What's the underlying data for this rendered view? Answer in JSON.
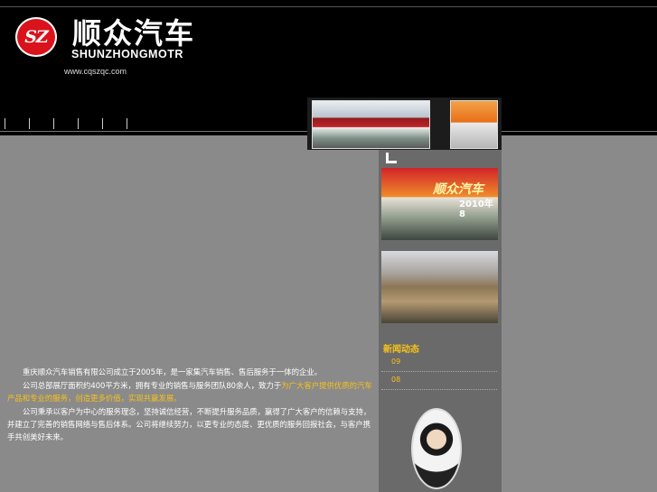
{
  "header": {
    "logo_mark": "SZ",
    "brand_cn": "顺众汽车",
    "brand_en": "SHUNZHONGMOTR",
    "url": "www.cqszqc.com"
  },
  "nav": {
    "items": [
      "",
      "",
      "",
      "",
      "",
      ""
    ]
  },
  "banner_photos": [
    "dealership-front-photo",
    "dealership-entrance-photo"
  ],
  "sidebar": {
    "photo_event_text": "顺众汽车",
    "photo_event_sub": "2010年8",
    "news_title": "新闻动态",
    "news_items": [
      {
        "date": "09"
      },
      {
        "date": "08"
      }
    ]
  },
  "content": {
    "p1": "重庆顺众汽车销售有限公司成立于2005年，是一家集汽车销售、售后服务于一体的企业。",
    "p2_a": "公司总部展厅面积约400平方米，拥有专业的销售与服务团队80余人，致力于",
    "p2_highlight": "为广大客户提供优质的汽车产品和专业的服务，创造更多价值，实现共赢发展。",
    "p3": "公司秉承以客户为中心的服务理念，坚持诚信经营，不断提升服务品质，赢得了广大客户的信赖与支持，并建立了完善的销售网络与售后体系。公司将继续努力，以更专业的态度、更优质的服务回报社会，与客户携手共创美好未来。"
  }
}
